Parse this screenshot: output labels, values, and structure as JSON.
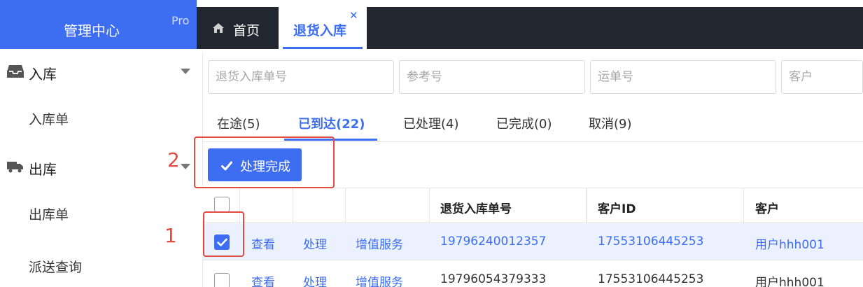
{
  "brand": {
    "title": "管理中心",
    "badge": "Pro"
  },
  "sidebar": {
    "groups": [
      {
        "label": "入库",
        "icon": "inbox-icon",
        "items": [
          "入库单"
        ]
      },
      {
        "label": "出库",
        "icon": "truck-icon",
        "items": [
          "出库单",
          "派送查询"
        ]
      }
    ]
  },
  "tabs": [
    {
      "label": "首页",
      "icon": "home-icon"
    },
    {
      "label": "退货入库",
      "close": "✕",
      "active": true
    }
  ],
  "filters": [
    {
      "placeholder": "退货入库单号"
    },
    {
      "placeholder": "参考号"
    },
    {
      "placeholder": "运单号"
    },
    {
      "placeholder": "客户"
    }
  ],
  "status_tabs": [
    "在途(5)",
    "已到达(22)",
    "已处理(4)",
    "已完成(0)",
    "取消(9)"
  ],
  "active_status_tab": "已到达(22)",
  "action": {
    "label": "处理完成",
    "icon": "check-icon"
  },
  "annotations": [
    "1",
    "2"
  ],
  "table": {
    "columns": [
      "",
      "",
      "",
      "",
      "退货入库单号",
      "客户ID",
      "客户"
    ],
    "rows": [
      {
        "checked": true,
        "actions": [
          "查看",
          "处理",
          "增值服务"
        ],
        "order_no": "19796240012357",
        "customer_id": "17553106445253",
        "customer": "用户hhh001"
      },
      {
        "checked": false,
        "actions": [
          "查看",
          "处理",
          "增值服务"
        ],
        "order_no": "19796054379333",
        "customer_id": "17553106445253",
        "customer": "用户hhh001"
      }
    ]
  },
  "colors": {
    "accent": "#3d6ef1",
    "topbar": "#22262e",
    "annotation": "#e24b3f",
    "selected_row": "#ebf1ff"
  }
}
